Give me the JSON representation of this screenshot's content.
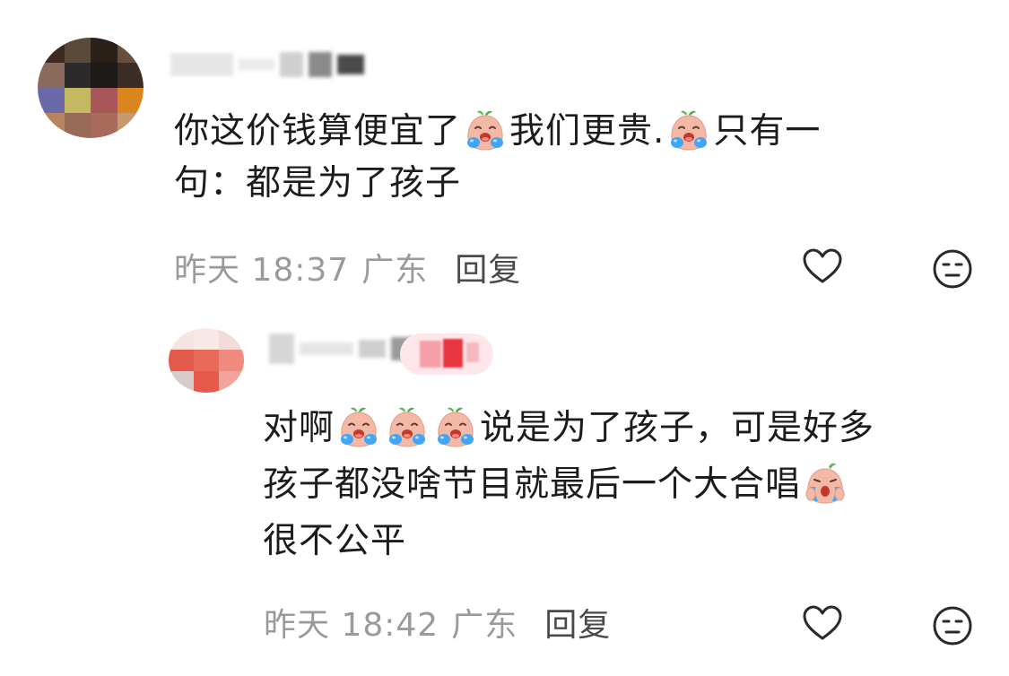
{
  "comments": [
    {
      "body_segments": [
        "你这价钱算便宜了",
        "我们更贵.",
        "只有一",
        "句：都是为了孩子"
      ],
      "emoji": "crying-face-emoji",
      "time": "昨天 18:37",
      "location": "广东",
      "reply_label": "回复"
    },
    {
      "body_segments": [
        "对啊",
        "说是为了孩子，可是好多",
        "孩子都没啥节目就最后一个大合唱",
        "很不公平"
      ],
      "emoji": "crying-face-emoji",
      "time": "昨天 18:42",
      "location": "广东",
      "reply_label": "回复"
    }
  ],
  "icons": {
    "like": "heart-icon",
    "dislike": "neutral-face-icon"
  },
  "colors": {
    "meta_text": "#9a9a9a",
    "reply_text": "#4a4a4a",
    "body_text": "#1c1c1c"
  }
}
